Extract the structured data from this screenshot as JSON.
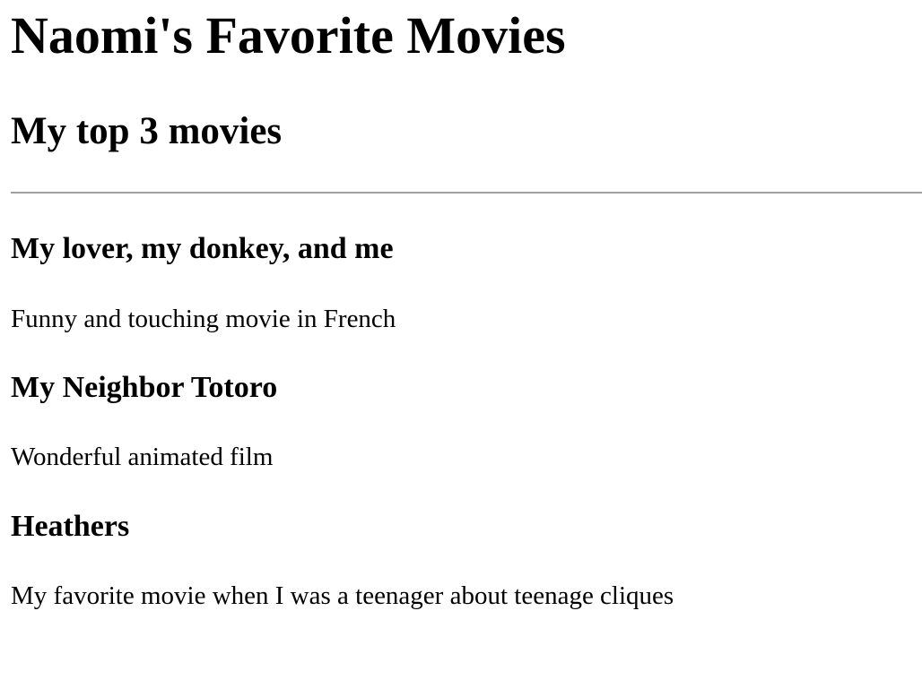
{
  "page": {
    "title": "Naomi's Favorite Movies",
    "subtitle": "My top 3 movies"
  },
  "movies": [
    {
      "title": "My lover, my donkey, and me",
      "description": "Funny and touching movie in French"
    },
    {
      "title": "My Neighbor Totoro",
      "description": "Wonderful animated film"
    },
    {
      "title": "Heathers",
      "description": "My favorite movie when I was a teenager about teenage cliques"
    }
  ]
}
